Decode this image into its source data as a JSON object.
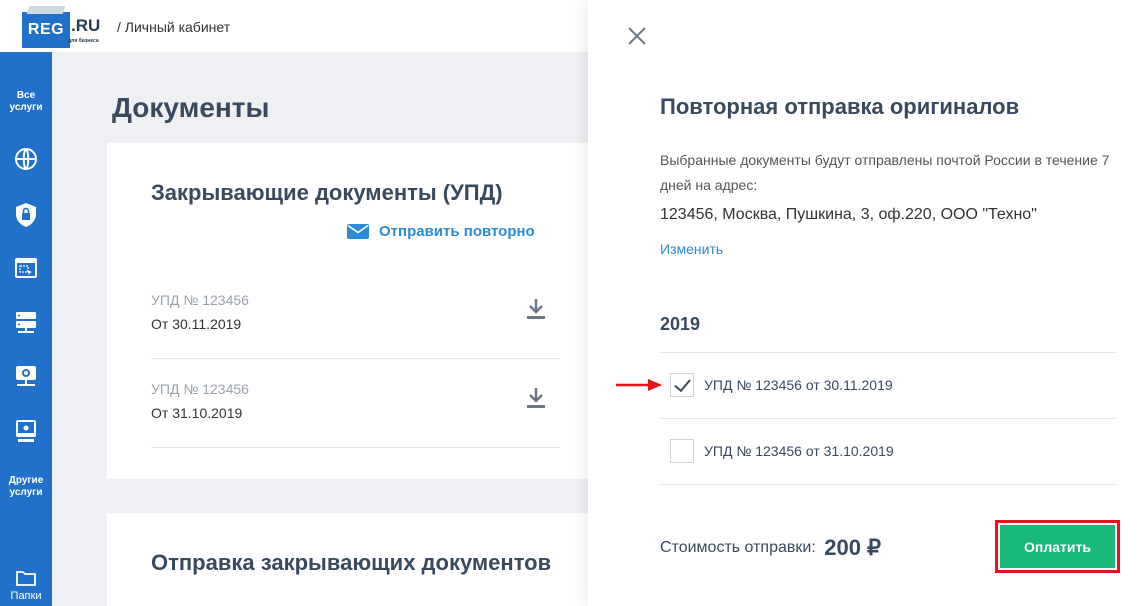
{
  "header": {
    "logo_main": "REG",
    "logo_ru": ".RU",
    "logo_sub": "для бизнеса",
    "breadcrumb": "/ Личный кабинет"
  },
  "sidebar": {
    "all_services": "Все услуги",
    "other_services": "Другие услуги",
    "folders": "Папки",
    "icons": [
      "globe-icon",
      "shield-icon",
      "website-builder-icon",
      "server-icon",
      "network-icon",
      "monitor-icon",
      "folder-icon"
    ]
  },
  "main": {
    "page_title": "Документы",
    "card1": {
      "title": "Закрывающие документы (УПД)",
      "resend_label": "Отправить повторно",
      "docs": [
        {
          "title": "УПД № 123456",
          "date": "От 30.11.2019"
        },
        {
          "title": "УПД № 123456",
          "date": "От 31.10.2019"
        }
      ]
    },
    "card2": {
      "title": "Отправка закрывающих документов"
    }
  },
  "panel": {
    "title": "Повторная отправка оригиналов",
    "description": "Выбранные документы будут отправлены почтой России в течение 7 дней на адрес:",
    "address": "123456, Москва, Пушкина, 3, оф.220, ООО \"Техно\"",
    "change_label": "Изменить",
    "year": "2019",
    "items": [
      {
        "label": "УПД № 123456 от 30.11.2019",
        "checked": true
      },
      {
        "label": "УПД № 123456 от 31.10.2019",
        "checked": false
      }
    ],
    "cost_label": "Стоимость отправки:",
    "cost_value": "200 ₽",
    "pay_label": "Оплатить"
  },
  "colors": {
    "brand_blue": "#2170c9",
    "link_blue": "#2a8bd6",
    "pay_green": "#19b979",
    "highlight_red": "#e0151b"
  }
}
